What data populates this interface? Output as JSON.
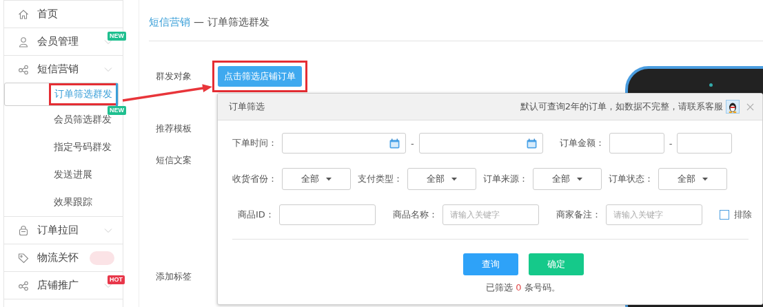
{
  "sidebar": {
    "items": [
      {
        "label": "首页"
      },
      {
        "label": "会员管理",
        "chevron": true,
        "badge": {
          "text": "NEW",
          "color": "#1fbf8f"
        }
      },
      {
        "label": "短信营销",
        "chevron": true,
        "children": [
          {
            "label": "订单筛选群发",
            "selected": true
          },
          {
            "label": "会员筛选群发",
            "selected": false,
            "badge": {
              "text": "NEW",
              "color": "#1fbf8f"
            }
          },
          {
            "label": "指定号码群发",
            "selected": false
          },
          {
            "label": "发送进展",
            "selected": false
          },
          {
            "label": "效果跟踪",
            "selected": false
          }
        ]
      },
      {
        "label": "订单拉回",
        "chevron": true
      },
      {
        "label": "物流关怀",
        "blurred_mark": true
      },
      {
        "label": "店铺推广",
        "chevron": true,
        "badge": {
          "text": "HOT",
          "color": "#e8374a"
        }
      }
    ]
  },
  "breadcrumb": {
    "parent": "短信营销",
    "separator": "—",
    "current": "订单筛选群发"
  },
  "form": [
    {
      "label": "群发对象",
      "button": "点击筛选店铺订单"
    },
    {
      "label": "推荐模板"
    },
    {
      "label": "短信文案"
    },
    {
      "label": "添加标签"
    }
  ],
  "dialog": {
    "title": "订单筛选",
    "notice": "默认可查询2年的订单，如数据不完整，请联系客服",
    "rows": [
      {
        "fields": [
          {
            "kind": "date_range",
            "label": "下单时间：",
            "separator": "-"
          },
          {
            "kind": "range",
            "label": "订单金额：",
            "separator": "-"
          }
        ]
      },
      {
        "fields": [
          {
            "kind": "select",
            "label": "收货省份：",
            "value": "全部"
          },
          {
            "kind": "select",
            "label": "支付类型：",
            "value": "全部"
          },
          {
            "kind": "select",
            "label": "订单来源：",
            "value": "全部"
          },
          {
            "kind": "select",
            "label": "订单状态：",
            "value": "全部"
          }
        ]
      },
      {
        "fields": [
          {
            "kind": "text",
            "label": "商品ID："
          },
          {
            "kind": "text",
            "label": "商品名称：",
            "placeholder": "请输入关键字"
          },
          {
            "kind": "text",
            "label": "商家备注：",
            "placeholder": "请输入关键字"
          },
          {
            "kind": "checkbox",
            "label": "排除",
            "checked": false
          }
        ]
      }
    ],
    "buttons": [
      "查询",
      "确定"
    ],
    "result": {
      "prefix": "已筛选",
      "count": "0",
      "suffix": "条号码。"
    }
  }
}
